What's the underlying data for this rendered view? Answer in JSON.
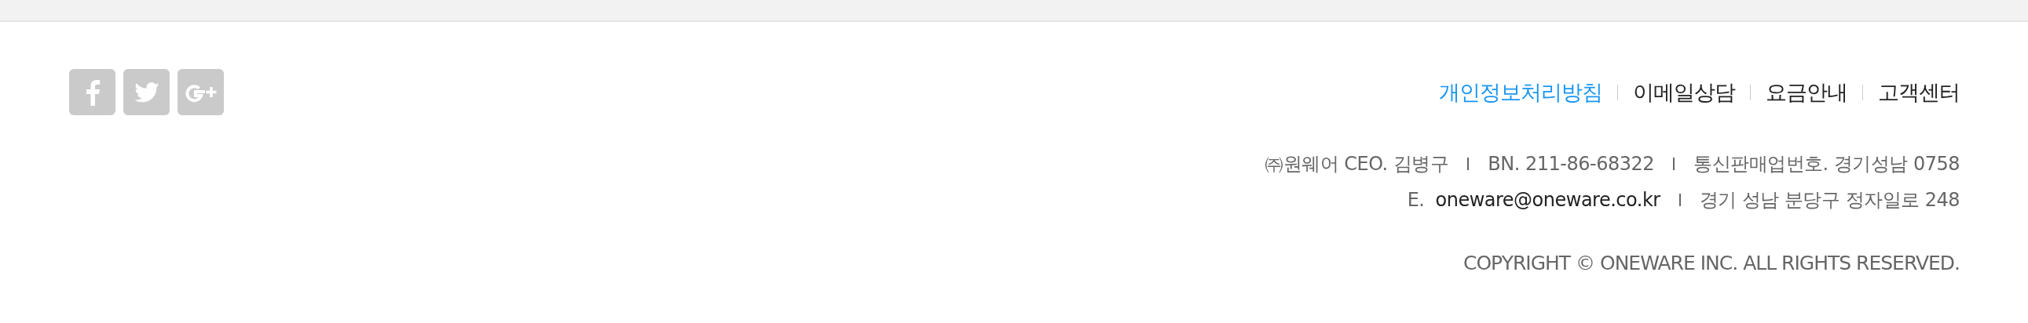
{
  "social": [
    {
      "kind": "facebook"
    },
    {
      "kind": "twitter"
    },
    {
      "kind": "googleplus"
    }
  ],
  "links": [
    {
      "label": "개인정보처리방침",
      "selected": true
    },
    {
      "label": "이메일상담",
      "selected": false
    },
    {
      "label": "요금안내",
      "selected": false
    },
    {
      "label": "고객센터",
      "selected": false
    }
  ],
  "company_info": {
    "line_1": [
      "㈜원웨어 CEO. 김병구",
      "BN. 211-86-68322",
      "통신판매업번호. 경기성남 0758"
    ],
    "email_label": "E.",
    "email": "oneware@oneware.co.kr",
    "address": "경기 성남 분당구 정자일로 248"
  },
  "copyright": "COPYRIGHT © ONEWARE INC. ALL RIGHTS RESERVED."
}
